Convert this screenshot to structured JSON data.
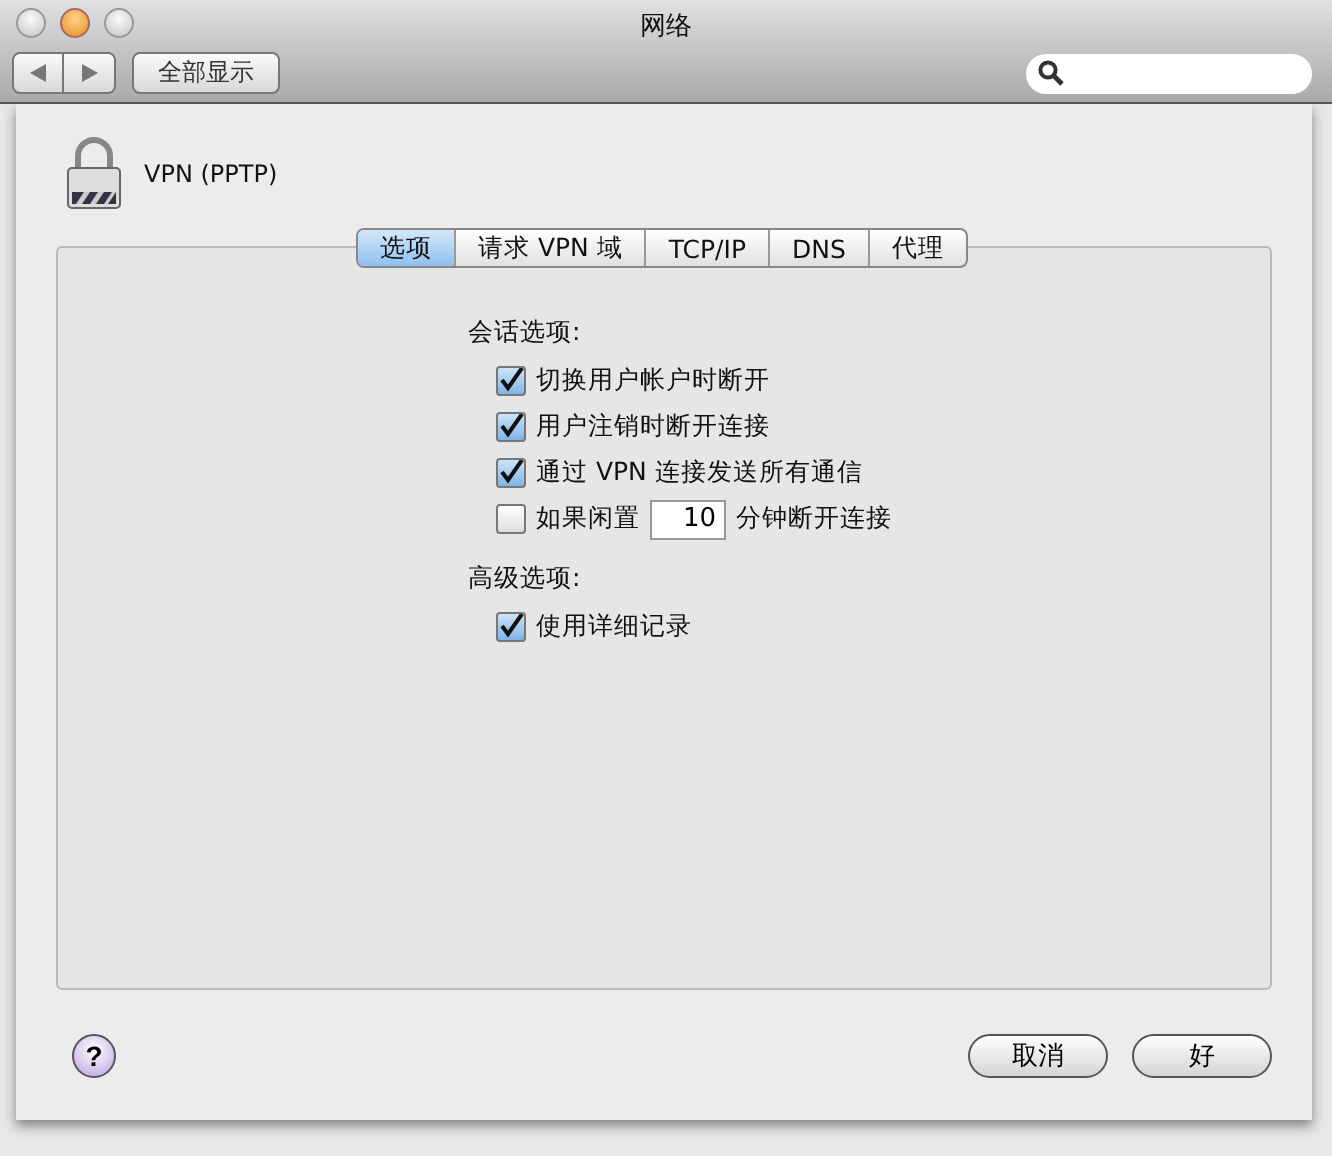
{
  "window": {
    "title": "网络",
    "toolbar": {
      "show_all": "全部显示"
    }
  },
  "sheet": {
    "service": "VPN (PPTP)",
    "tabs": [
      {
        "label": "选项",
        "selected": true
      },
      {
        "label": "请求 VPN 域",
        "selected": false
      },
      {
        "label": "TCP/IP",
        "selected": false
      },
      {
        "label": "DNS",
        "selected": false
      },
      {
        "label": "代理",
        "selected": false
      }
    ],
    "sections": [
      {
        "title": "会话选项:",
        "options": [
          {
            "kind": "check",
            "label": "切换用户帐户时断开",
            "checked": true
          },
          {
            "kind": "check",
            "label": "用户注销时断开连接",
            "checked": true
          },
          {
            "kind": "check",
            "label": "通过 VPN 连接发送所有通信",
            "checked": true
          },
          {
            "kind": "idle",
            "label": "如果闲置",
            "value": "10",
            "suffix": "分钟断开连接",
            "checked": false
          }
        ]
      },
      {
        "title": "高级选项:",
        "options": [
          {
            "kind": "check",
            "label": "使用详细记录",
            "checked": true
          }
        ]
      }
    ],
    "help": "?",
    "buttons": [
      "取消",
      "好"
    ]
  }
}
